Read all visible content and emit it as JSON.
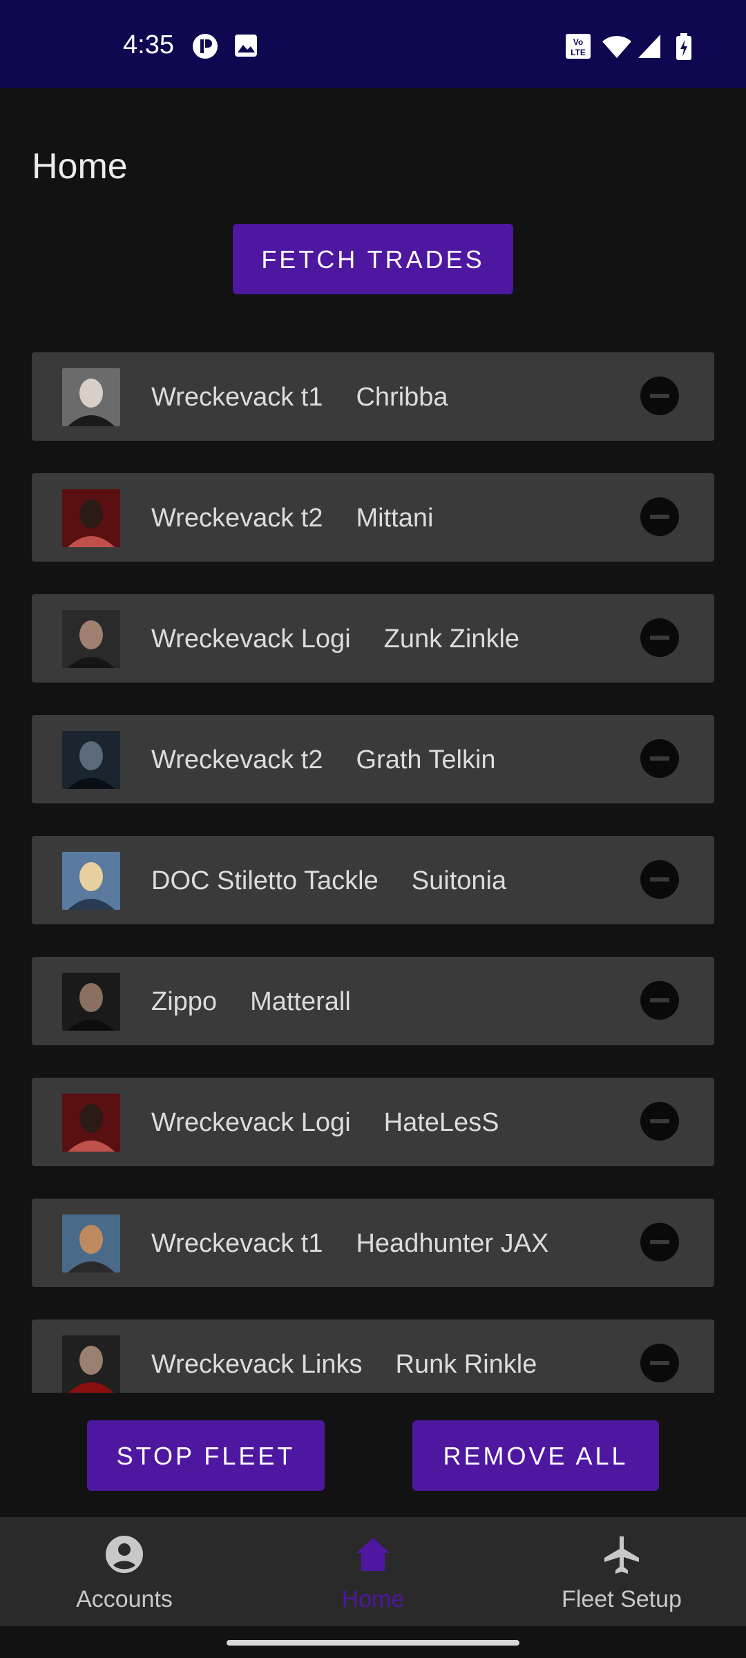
{
  "status_bar": {
    "time": "4:35"
  },
  "header": {
    "title": "Home"
  },
  "actions": {
    "fetch_label": "FETCH TRADES",
    "stop_label": "STOP FLEET",
    "remove_all_label": "REMOVE ALL"
  },
  "fleet": [
    {
      "ship": "Wreckevack t1",
      "pilot": "Chribba",
      "avatar": "avatar-white-haired-man"
    },
    {
      "ship": "Wreckevack t2",
      "pilot": "Mittani",
      "avatar": "avatar-woman-dark-hair-red-bg"
    },
    {
      "ship": "Wreckevack Logi",
      "pilot": "Zunk Zinkle",
      "avatar": "avatar-man-dark-hair"
    },
    {
      "ship": "Wreckevack t2",
      "pilot": "Grath Telkin",
      "avatar": "avatar-armored-man"
    },
    {
      "ship": "DOC Stiletto Tackle",
      "pilot": "Suitonia",
      "avatar": "avatar-blonde-woman"
    },
    {
      "ship": "Zippo",
      "pilot": "Matterall",
      "avatar": "avatar-man-side-profile"
    },
    {
      "ship": "Wreckevack Logi",
      "pilot": "HateLesS",
      "avatar": "avatar-woman-dark-hair-red-bg"
    },
    {
      "ship": "Wreckevack t1",
      "pilot": "Headhunter JAX",
      "avatar": "avatar-bald-man"
    },
    {
      "ship": "Wreckevack Links",
      "pilot": "Runk Rinkle",
      "avatar": "avatar-man-red-star"
    }
  ],
  "nav": {
    "items": [
      {
        "label": "Accounts",
        "icon": "account-circle-icon",
        "active": false
      },
      {
        "label": "Home",
        "icon": "home-icon",
        "active": true
      },
      {
        "label": "Fleet Setup",
        "icon": "airplane-icon",
        "active": false
      }
    ]
  },
  "colors": {
    "primary": "#4d17a0",
    "status_bar": "#0e0851",
    "background": "#121212",
    "row": "#3a3a3a",
    "nav_bg": "#2a2a2a",
    "nav_active": "#4d17a0",
    "nav_inactive": "#c8c8c8"
  }
}
